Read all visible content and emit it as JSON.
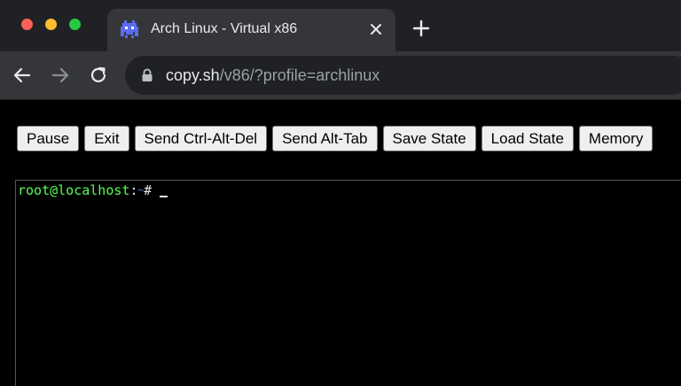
{
  "window": {
    "traffic_lights": [
      "#ff5f57",
      "#febc2e",
      "#28c840"
    ]
  },
  "tab": {
    "title": "Arch Linux - Virtual x86",
    "favicon": "v86-invader-icon"
  },
  "toolbar": {
    "back_icon": "back-arrow-icon",
    "forward_icon": "forward-arrow-icon",
    "reload_icon": "reload-icon",
    "url_host": "copy.sh",
    "url_rest": "/v86/?profile=archlinux"
  },
  "controls": {
    "buttons": [
      "Pause",
      "Exit",
      "Send Ctrl-Alt-Del",
      "Send Alt-Tab",
      "Save State",
      "Load State",
      "Memory"
    ]
  },
  "terminal": {
    "user_host": "root@localhost",
    "separator": ":",
    "path": "~",
    "symbol": "#",
    "colors": {
      "user": "#54ff54",
      "path": "#5c8cff",
      "text": "#e5e5e5"
    }
  }
}
